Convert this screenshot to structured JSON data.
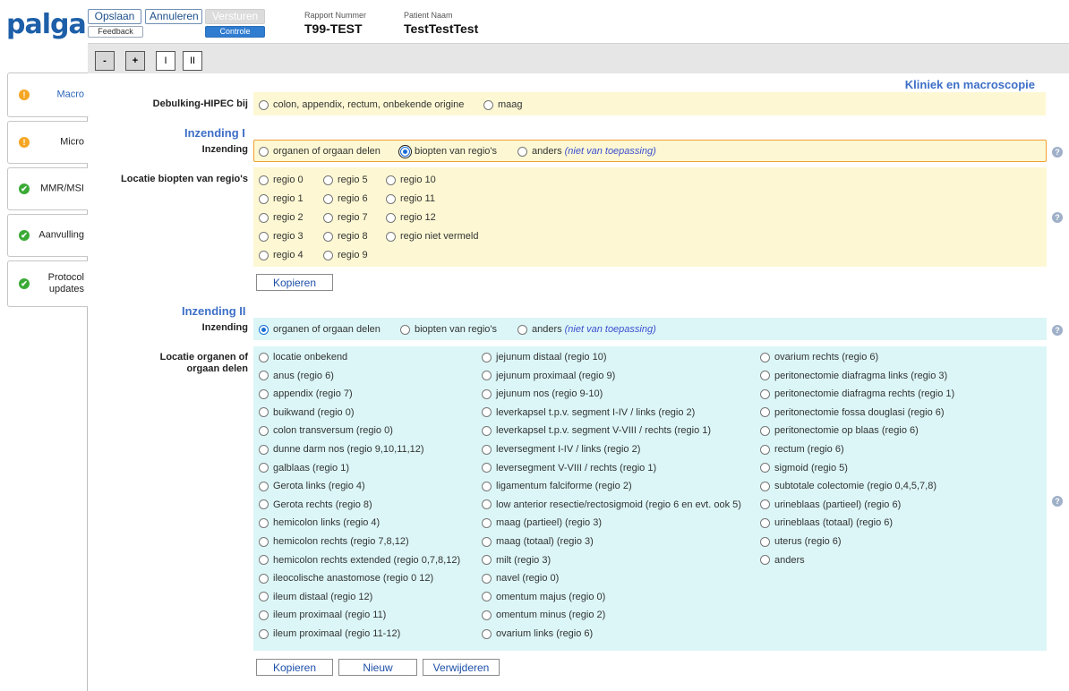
{
  "header": {
    "logo": "palga",
    "save_label": "Opslaan",
    "cancel_label": "Annuleren",
    "send_label": "Versturen",
    "feedback_label": "Feedback",
    "controle_label": "Controle",
    "report_number_label": "Rapport Nummer",
    "report_number": "T99-TEST",
    "patient_name_label": "Patient Naam",
    "patient_name": "TestTestTest"
  },
  "toolbar": {
    "minus": "-",
    "plus": "+",
    "one": "I",
    "two": "II"
  },
  "sidebar": {
    "tabs": [
      {
        "label": "Macro",
        "status": "warning",
        "icon": "!"
      },
      {
        "label": "Micro",
        "status": "warning",
        "icon": "!"
      },
      {
        "label": "MMR/MSI",
        "status": "ok",
        "icon": "✔"
      },
      {
        "label": "Aanvulling",
        "status": "ok",
        "icon": "✔"
      },
      {
        "label": "Protocol updates",
        "status": "ok",
        "icon": "✔"
      }
    ]
  },
  "main": {
    "section_title": "Kliniek en macroscopie",
    "debulking": {
      "label": "Debulking-HIPEC bij",
      "options": [
        "colon, appendix, rectum, onbekende origine",
        "maag"
      ]
    },
    "inzending1": {
      "title": "Inzending I",
      "inzending_label": "Inzending",
      "options": [
        "organen of orgaan delen",
        "biopten van regio's",
        "anders"
      ],
      "na_label": "(niet van toepassing)",
      "selected": "biopten van regio's",
      "location_label": "Locatie biopten van regio's",
      "regions": [
        [
          "regio 0",
          "regio 5",
          "regio 10"
        ],
        [
          "regio 1",
          "regio 6",
          "regio 11"
        ],
        [
          "regio 2",
          "regio 7",
          "regio 12"
        ],
        [
          "regio 3",
          "regio 8",
          "regio niet vermeld"
        ],
        [
          "regio 4",
          "regio 9",
          ""
        ]
      ],
      "copy_label": "Kopieren"
    },
    "inzending2": {
      "title": "Inzending II",
      "inzending_label": "Inzending",
      "options": [
        "organen of orgaan delen",
        "biopten van regio's",
        "anders"
      ],
      "na_label": "(niet van toepassing)",
      "selected": "organen of orgaan delen",
      "location_label": "Locatie organen of orgaan delen",
      "organs": [
        [
          "locatie onbekend",
          "anus (regio 6)",
          "appendix (regio 7)",
          "buikwand (regio 0)",
          "colon transversum (regio 0)",
          "dunne darm nos (regio 9,10,11,12)",
          "galblaas (regio 1)",
          "Gerota links (regio 4)",
          "Gerota rechts (regio 8)",
          "hemicolon links (regio 4)",
          "hemicolon rechts (regio 7,8,12)",
          "hemicolon rechts extended (regio 0,7,8,12)",
          "ileocolische anastomose (regio 0 12)",
          "ileum distaal (regio 12)",
          "ileum proximaal (regio 11)",
          "ileum proximaal (regio 11-12)"
        ],
        [
          "jejunum distaal (regio 10)",
          "jejunum proximaal (regio 9)",
          "jejunum nos (regio 9-10)",
          "leverkapsel t.p.v. segment I-IV / links (regio 2)",
          "leverkapsel t.p.v. segment V-VIII / rechts (regio 1)",
          "leversegment I-IV / links (regio 2)",
          "leversegment V-VIII / rechts (regio 1)",
          "ligamentum falciforme (regio 2)",
          "low anterior resectie/rectosigmoid (regio 6 en evt. ook 5)",
          "maag (partieel) (regio 3)",
          "maag (totaal) (regio 3)",
          "milt (regio 3)",
          "navel (regio 0)",
          "omentum majus (regio 0)",
          "omentum minus (regio 2)",
          "ovarium links (regio 6)"
        ],
        [
          "ovarium rechts (regio 6)",
          "peritonectomie diafragma links (regio 3)",
          "peritonectomie diafragma rechts (regio 1)",
          "peritonectomie fossa douglasi (regio 6)",
          "peritonectomie op blaas (regio 6)",
          "rectum (regio 6)",
          "sigmoid (regio 5)",
          "subtotale colectomie (regio 0,4,5,7,8)",
          "urineblaas (partieel) (regio 6)",
          "urineblaas (totaal) (regio 6)",
          "uterus (regio 6)",
          "anders"
        ]
      ],
      "copy_label": "Kopieren",
      "new_label": "Nieuw",
      "delete_label": "Verwijderen"
    },
    "help_icon": "?"
  }
}
